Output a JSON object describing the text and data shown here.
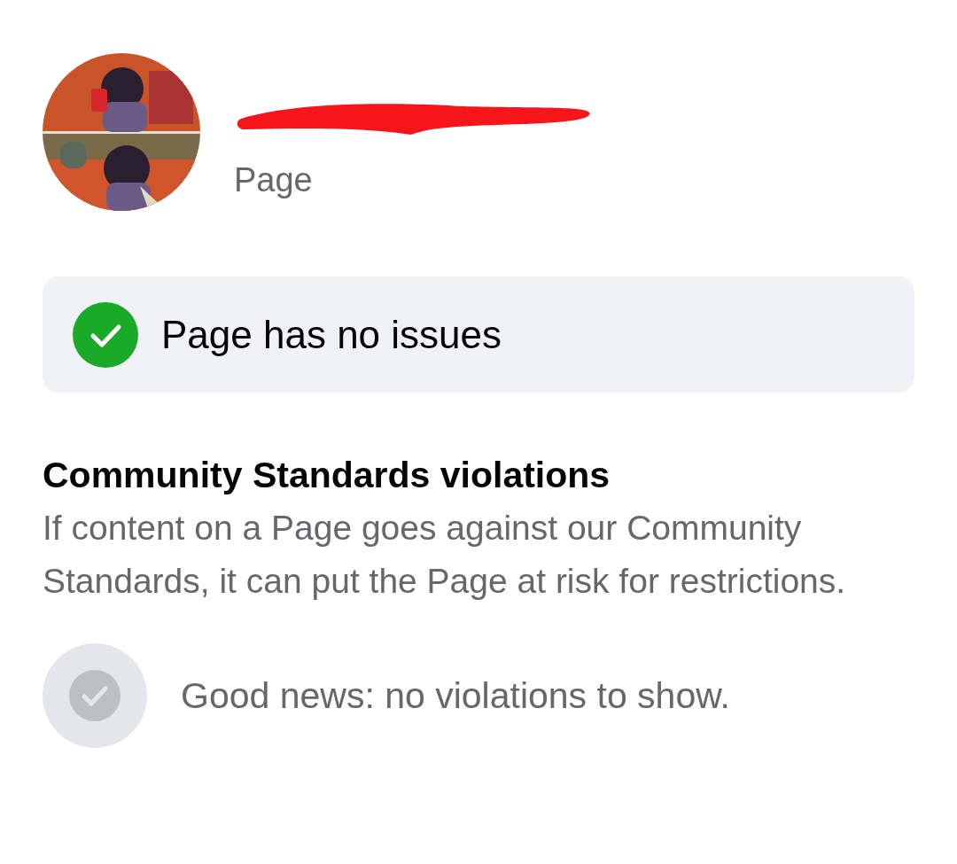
{
  "profile": {
    "name_redacted": true,
    "category": "Page"
  },
  "status": {
    "label": "Page has no issues",
    "ok": true
  },
  "violations": {
    "title": "Community Standards violations",
    "description": "If content on a Page goes against our Community Standards, it can put the Page at risk for restrictions.",
    "empty_message": "Good news: no violations to show."
  }
}
